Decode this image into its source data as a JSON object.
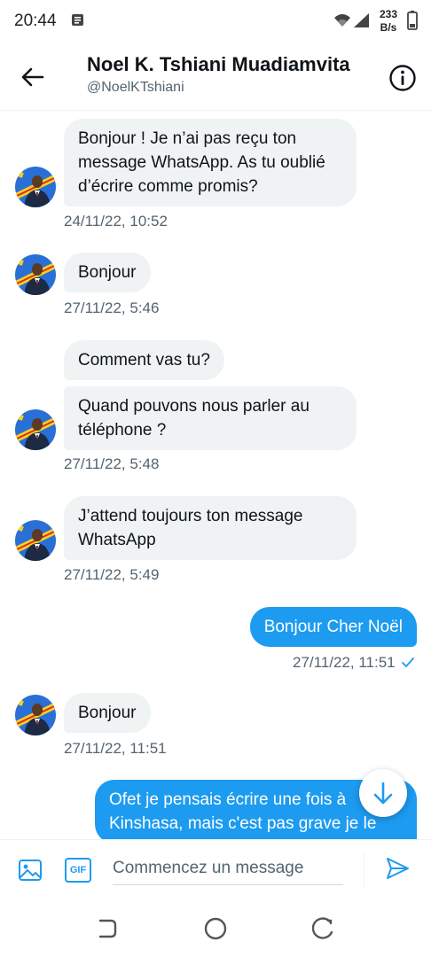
{
  "status_bar": {
    "time": "20:44",
    "speed_value": "233",
    "speed_unit": "B/s"
  },
  "header": {
    "name": "Noel K. Tshiani Muadiamvita",
    "handle": "@NoelKTshiani"
  },
  "messages": [
    {
      "text": "Bonjour ! Je n’ai pas reçu ton message WhatsApp. As tu oublié d’écrire comme promis?",
      "time": "24/11/22, 10:52"
    },
    {
      "text": "Bonjour",
      "time": "27/11/22, 5:46"
    },
    {
      "text": "Comment vas tu?"
    },
    {
      "text": "Quand pouvons nous parler au téléphone ?",
      "time": "27/11/22, 5:48"
    },
    {
      "text": "J’attend toujours ton message WhatsApp",
      "time": "27/11/22, 5:49"
    },
    {
      "text": "Bonjour Cher Noël",
      "time": "27/11/22, 11:51"
    },
    {
      "text": "Bonjour",
      "time": "27/11/22, 11:51"
    },
    {
      "text": "Ofet je pensais écrire une fois à Kinshasa, mais c'est pas grave je le"
    }
  ],
  "composer": {
    "placeholder": "Commencez un message",
    "gif_label": "GIF"
  },
  "colors": {
    "accent": "#1d9bf0",
    "bubble_in": "#eff3f4",
    "text_secondary": "#536471"
  },
  "icons": [
    "back-arrow-icon",
    "info-icon",
    "image-icon",
    "gif-icon",
    "send-icon",
    "scroll-down-icon",
    "read-check-icon"
  ]
}
